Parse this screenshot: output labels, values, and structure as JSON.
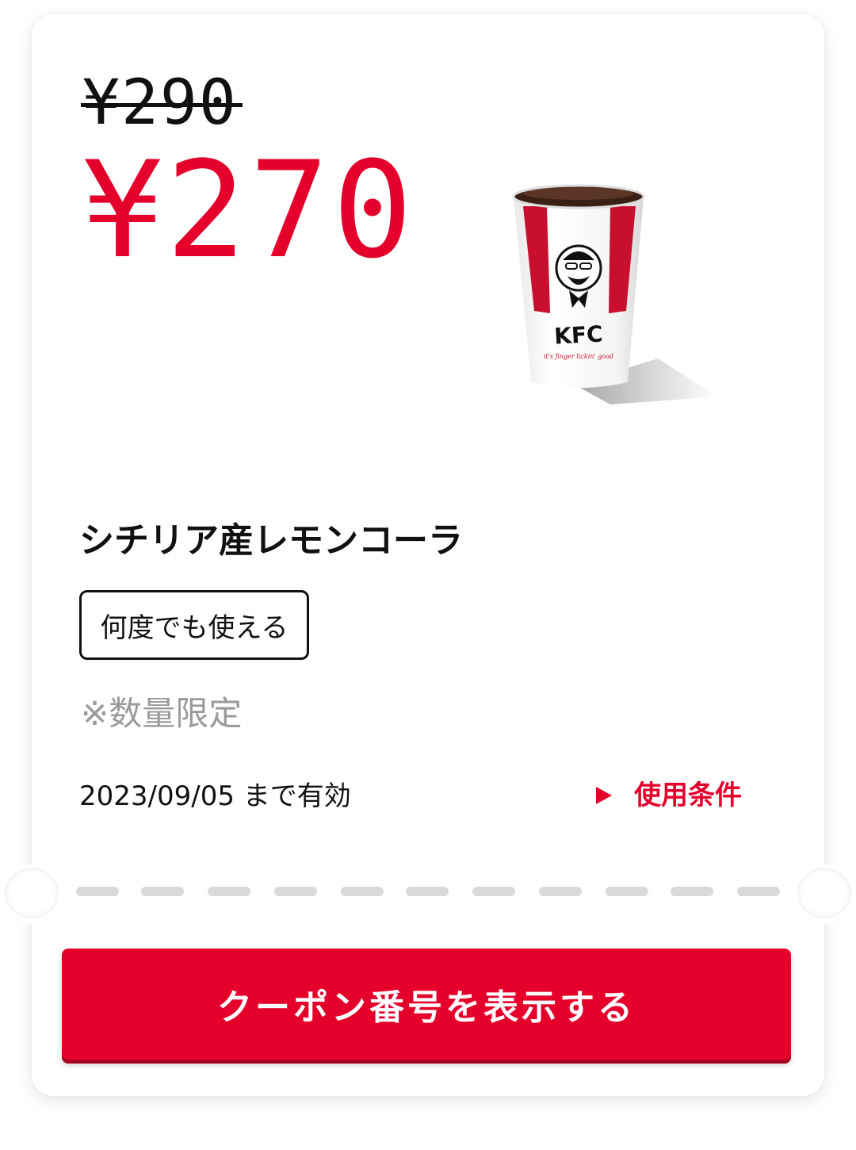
{
  "coupon": {
    "original_price": "¥290",
    "discount_price": "¥270",
    "product_image": "kfc-cola-cup",
    "product_name": "シチリア産レモンコーラ",
    "badge": "何度でも使える",
    "limited_note": "※数量限定",
    "expiry": "2023/09/05 まで有効",
    "terms_label": "使用条件",
    "cta_label": "クーポン番号を表示する"
  },
  "colors": {
    "brand_red": "#e4002b",
    "text": "#111111",
    "muted": "#9a9a9a",
    "dash": "#d9d9d9"
  }
}
